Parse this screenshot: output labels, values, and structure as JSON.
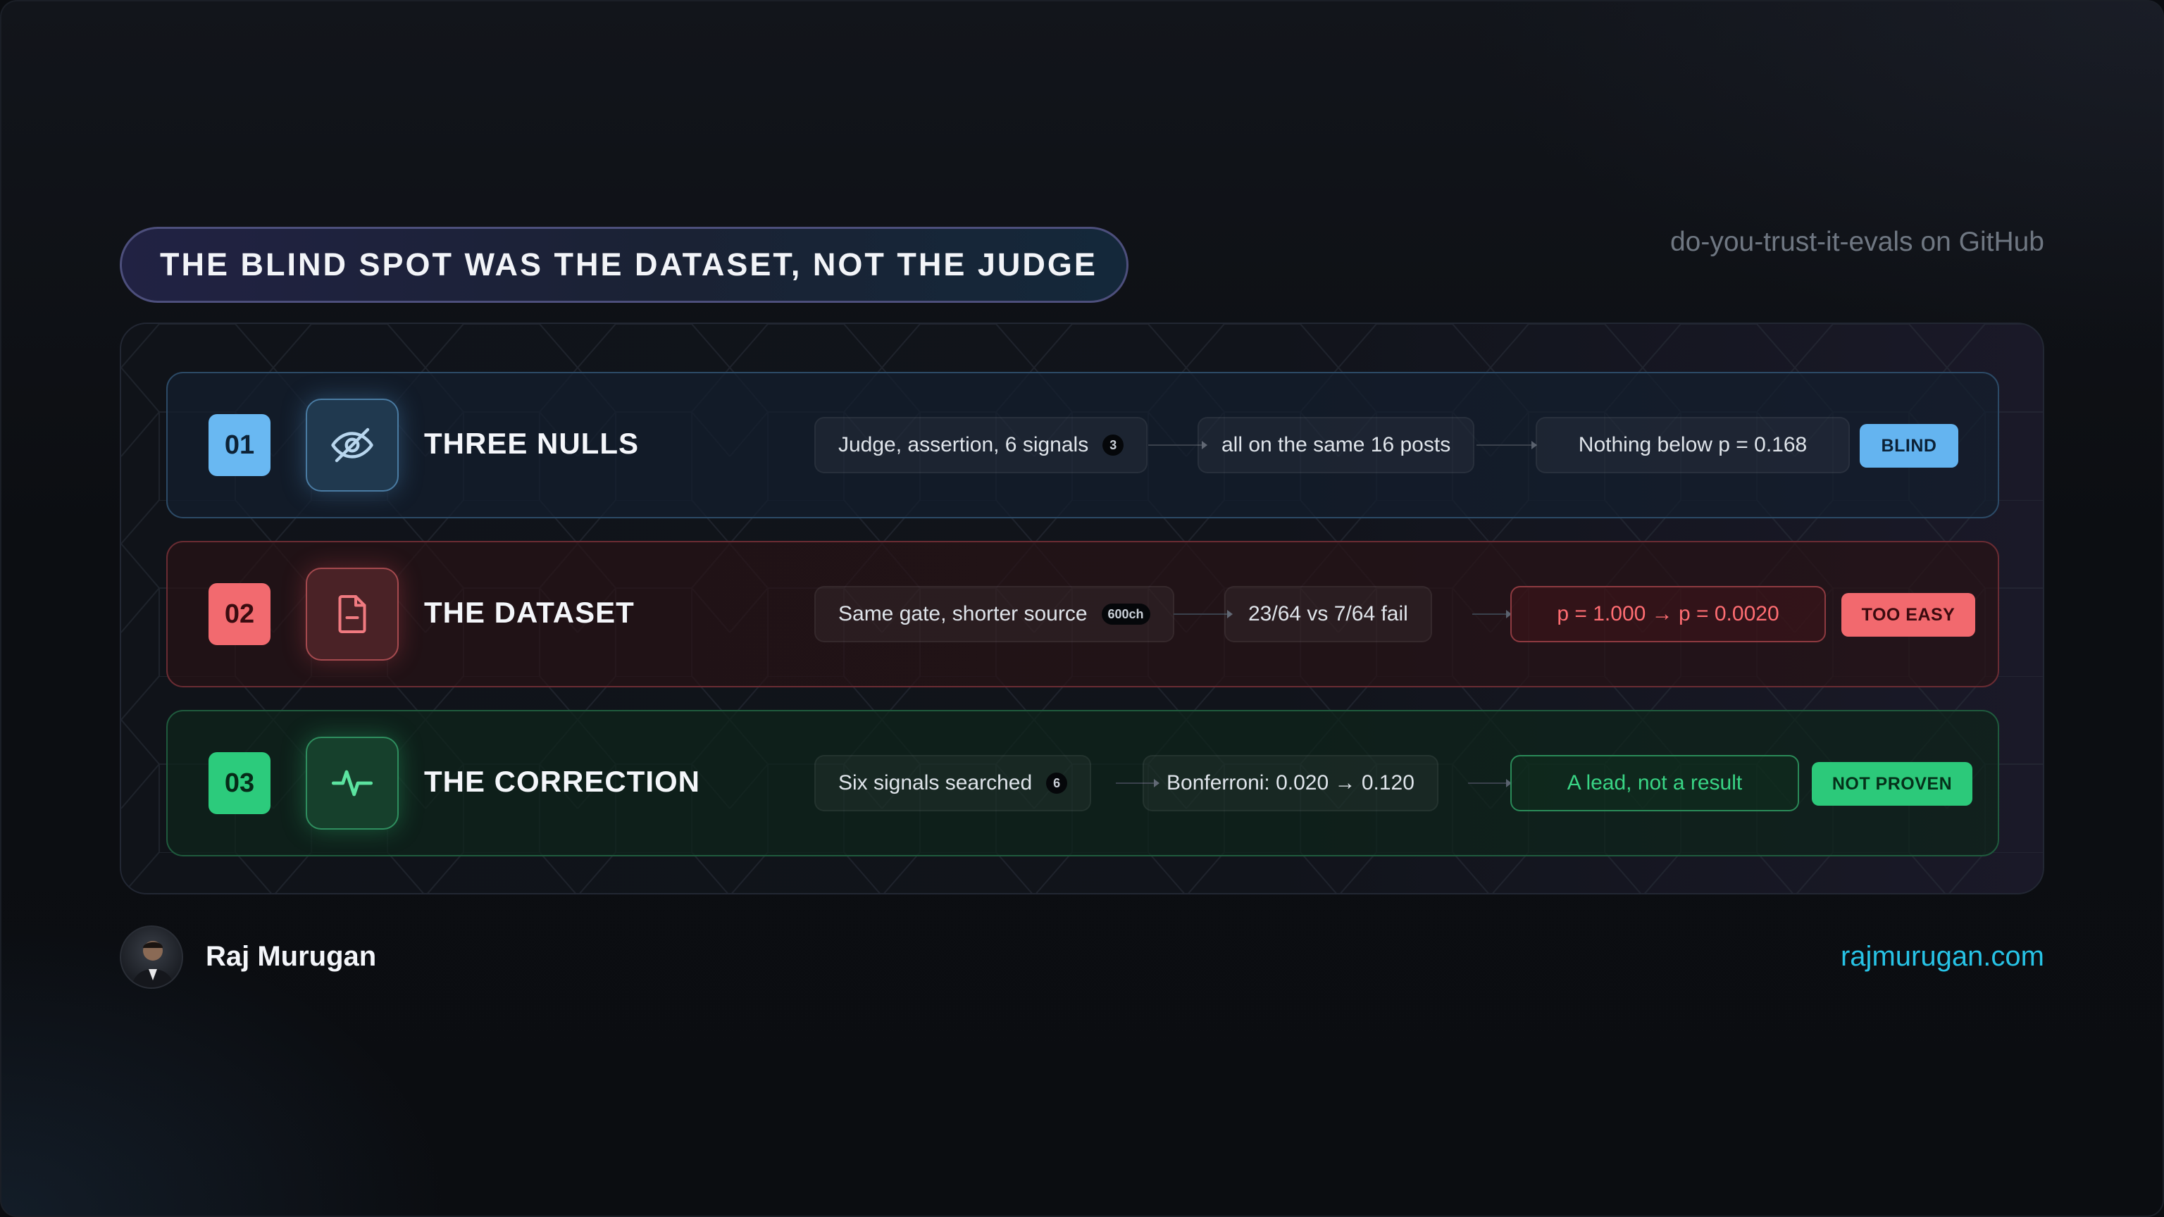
{
  "header": {
    "title": "THE BLIND SPOT WAS THE DATASET, NOT THE JUDGE",
    "repo_link": "do-you-trust-it-evals on GitHub"
  },
  "rows": [
    {
      "number": "01",
      "icon": "eye-off-icon",
      "title": "THREE NULLS",
      "steps": [
        {
          "text": "Judge, assertion, 6 signals",
          "badge": "3"
        },
        {
          "text": "all on the same 16 posts"
        },
        {
          "text": "Nothing below p = 0.168"
        }
      ],
      "status": "BLIND",
      "accent": "#64b4f0"
    },
    {
      "number": "02",
      "icon": "document-icon",
      "title": "THE DATASET",
      "steps": [
        {
          "text": "Same gate, shorter source",
          "badge": "600ch"
        },
        {
          "text": "23/64 vs 7/64 fail"
        },
        {
          "text": "p = 1.000 → p = 0.0020"
        }
      ],
      "status": "TOO EASY",
      "accent": "#f2696e"
    },
    {
      "number": "03",
      "icon": "pulse-icon",
      "title": "THE CORRECTION",
      "steps": [
        {
          "text": "Six signals searched",
          "badge": "6"
        },
        {
          "text": "Bonferroni: 0.020 → 0.120"
        },
        {
          "text": "A lead, not a result"
        }
      ],
      "status": "NOT PROVEN",
      "accent": "#2cc97a"
    }
  ],
  "footer": {
    "author": "Raj Murugan",
    "website": "rajmurugan.com"
  }
}
